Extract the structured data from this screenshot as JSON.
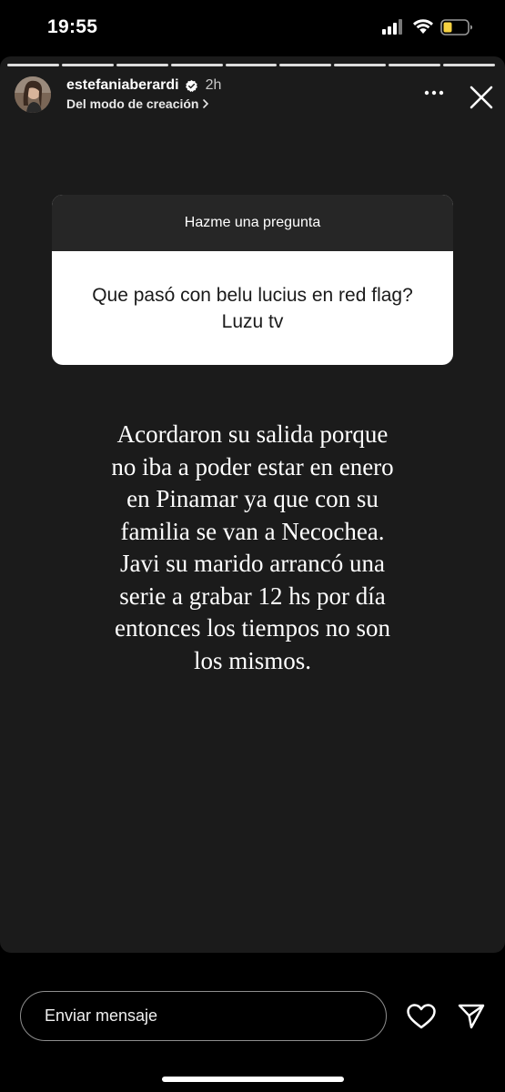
{
  "status_bar": {
    "time": "19:55",
    "icons": [
      "cellular-signal-icon",
      "wifi-icon",
      "battery-icon"
    ],
    "battery_color": "#f5d142"
  },
  "story": {
    "progress_segments": 9,
    "author": {
      "username": "estefaniaberardi",
      "verified": true,
      "time_ago": "2h",
      "source_label": "Del modo de creación"
    },
    "question_sticker": {
      "prompt": "Hazme una pregunta",
      "question": "Que pasó con belu lucius en red flag? Luzu tv"
    },
    "answer_lines": [
      "Acordaron su salida porque",
      "no iba a poder estar en enero",
      "en Pinamar ya que con su",
      "familia se van a Necochea.",
      "Javi su marido arrancó una",
      "serie a grabar 12 hs por día",
      "entonces los tiempos no son",
      "los mismos."
    ]
  },
  "reply_bar": {
    "placeholder": "Enviar mensaje"
  },
  "colors": {
    "background": "#000000",
    "story_background": "#1b1b1b",
    "sticker_header": "#262626",
    "sticker_body": "#ffffff",
    "verified_badge": "#ffffff"
  }
}
